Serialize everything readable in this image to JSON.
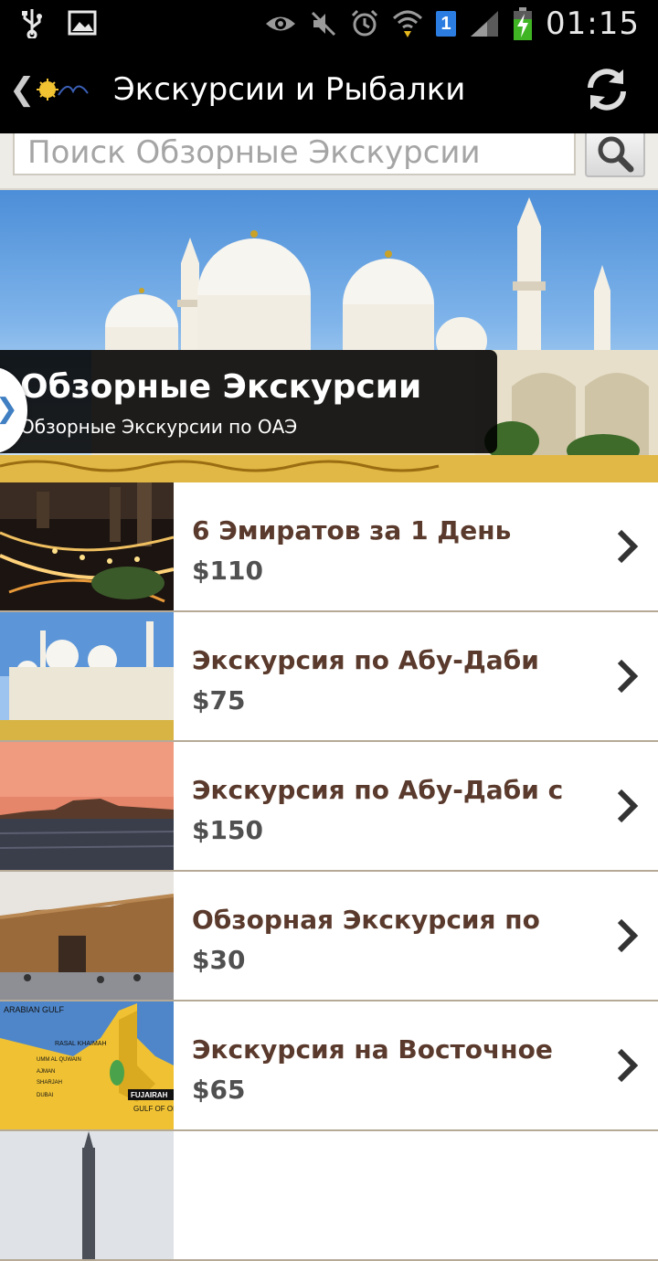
{
  "status_bar": {
    "time": "01:15",
    "sim_number": "1",
    "icons": [
      "usb-icon",
      "image-icon",
      "eye-icon",
      "mute-icon",
      "alarm-icon",
      "wifi-icon",
      "signal-icon",
      "battery-charging-icon"
    ]
  },
  "action_bar": {
    "back_glyph": "❮",
    "logo": "app-logo",
    "title": "Экскурсии и Рыбалки",
    "refresh_icon": "refresh-icon"
  },
  "search": {
    "placeholder": "Поиск Обзорные Экскурсии",
    "button_icon": "search-icon"
  },
  "hero": {
    "title": "Обзорные Экскурсии",
    "subtitle": "Обзорные Экскурсии по ОАЭ",
    "toggle_glyph": "❯"
  },
  "items": [
    {
      "title": "6 Эмиратов за 1 День",
      "price": "$110"
    },
    {
      "title": "Экскурсия по Абу-Даби",
      "price": "$75"
    },
    {
      "title": "Экскурсия по Абу-Даби с",
      "price": "$150"
    },
    {
      "title": "Обзорная Экскурсия по",
      "price": "$30"
    },
    {
      "title": "Экскурсия на Восточное",
      "price": "$65"
    }
  ],
  "map_labels": {
    "arabian_gulf": "ARABIAN GULF",
    "rasal_khaimah": "RASAL KHAIMAH",
    "umm_al_quwain": "UMM AL QUWAIN",
    "ajman": "AJMAN",
    "sharjah": "SHARJAH",
    "dubai": "DUBAI",
    "fujairah": "FUJAIRAH",
    "gulf_of_oman": "GULF OF OMAN"
  }
}
